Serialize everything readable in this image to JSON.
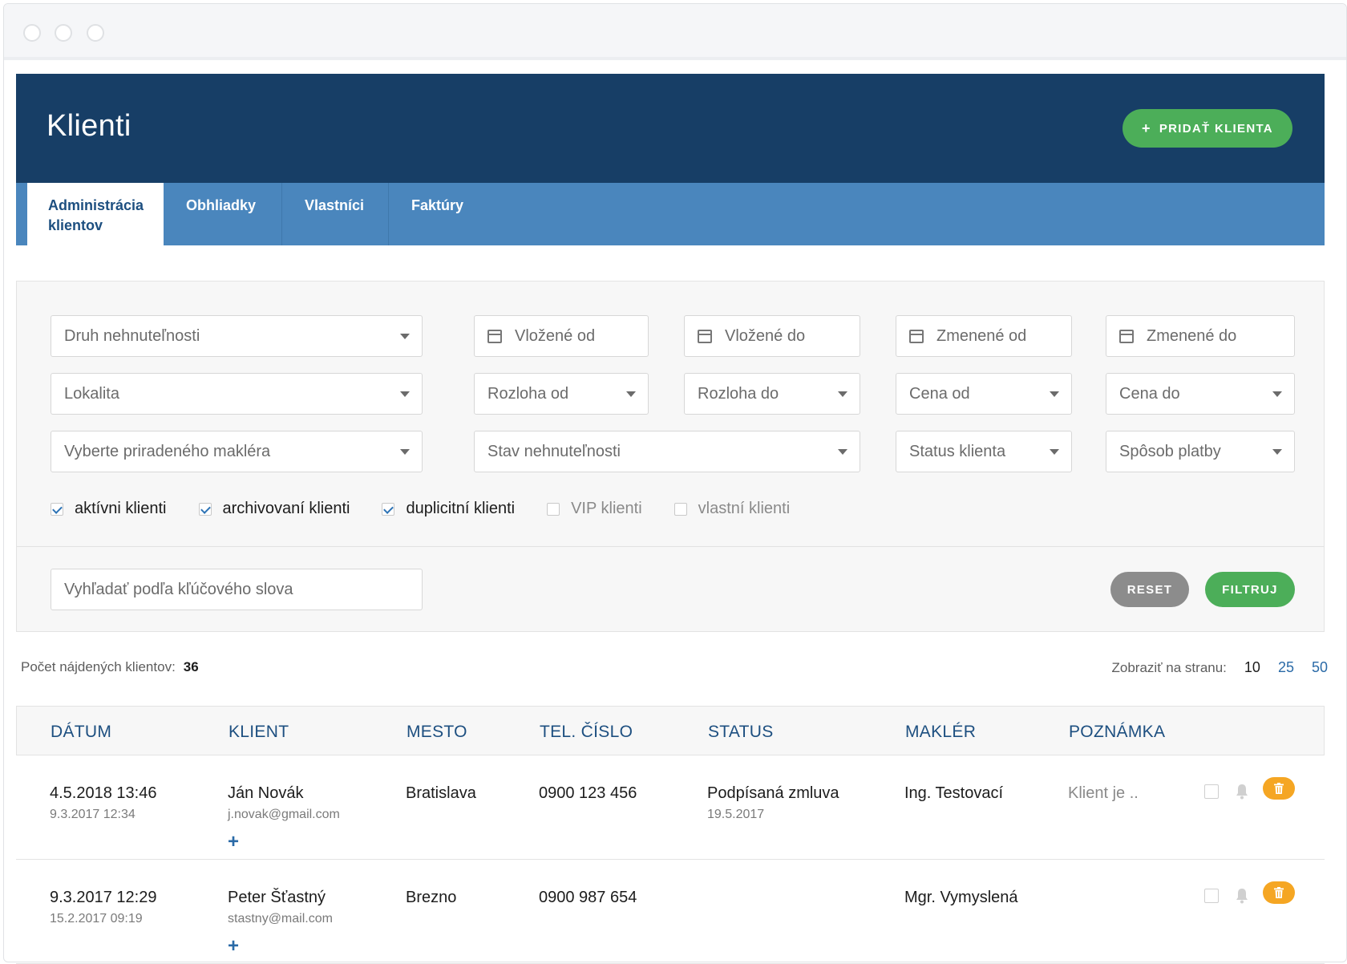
{
  "header": {
    "title": "Klienti",
    "add_button_label": "PRIDAŤ KLIENTA",
    "add_button_icon": "+"
  },
  "tabs": [
    {
      "label": "Administrácia klientov",
      "active": true
    },
    {
      "label": "Obhliadky",
      "active": false
    },
    {
      "label": "Vlastníci",
      "active": false
    },
    {
      "label": "Faktúry",
      "active": false
    }
  ],
  "filters": {
    "property_type": "Druh nehnuteľnosti",
    "inserted_from": "Vložené od",
    "inserted_to": "Vložené do",
    "changed_from": "Zmenené od",
    "changed_to": "Zmenené do",
    "locality": "Lokalita",
    "area_from": "Rozloha od",
    "area_to": "Rozloha do",
    "price_from": "Cena od",
    "price_to": "Cena do",
    "broker": "Vyberte priradeného makléra",
    "property_state": "Stav nehnuteľnosti",
    "client_status": "Status klienta",
    "payment_method": "Spôsob platby",
    "checkboxes": [
      {
        "label": "aktívni klienti",
        "checked": true
      },
      {
        "label": "archivovaní klienti",
        "checked": true
      },
      {
        "label": "duplicitní klienti",
        "checked": true
      },
      {
        "label": "VIP klienti",
        "checked": false
      },
      {
        "label": "vlastní klienti",
        "checked": false
      }
    ],
    "keyword_placeholder": "Vyhľadať podľa kľúčového slova",
    "reset_label": "RESET",
    "filter_label": "FILTRUJ"
  },
  "results": {
    "count_label": "Počet nájdených klientov:",
    "count": "36",
    "per_page_label": "Zobraziť na stranu:",
    "per_page_options": [
      "10",
      "25",
      "50"
    ],
    "per_page_selected": "10"
  },
  "table": {
    "columns": [
      "DÁTUM",
      "KLIENT",
      "MESTO",
      "TEL. ČÍSLO",
      "STATUS",
      "MAKLÉR",
      "POZNÁMKA"
    ],
    "rows": [
      {
        "date": "4.5.2018 13:46",
        "date_sub": "9.3.2017 12:34",
        "client": "Ján Novák",
        "email": "j.novak@gmail.com",
        "city": "Bratislava",
        "phone": "0900 123 456",
        "status": "Podpísaná zmluva",
        "status_sub": "19.5.2017",
        "broker": "Ing. Testovací",
        "note": "Klient je .."
      },
      {
        "date": "9.3.2017 12:29",
        "date_sub": "15.2.2017 09:19",
        "client": "Peter Šťastný",
        "email": "stastny@mail.com",
        "city": "Brezno",
        "phone": "0900 987 654",
        "status": "",
        "status_sub": "",
        "broker": "Mgr. Vymyslená",
        "note": ""
      }
    ],
    "add_icon": "+"
  },
  "colors": {
    "header_bg": "#173e66",
    "tab_bg": "#4a86bd",
    "primary_green": "#4cae59",
    "reset_gray": "#8c8c8c",
    "trash_orange": "#f5a623",
    "link_blue": "#2a6aa7"
  }
}
